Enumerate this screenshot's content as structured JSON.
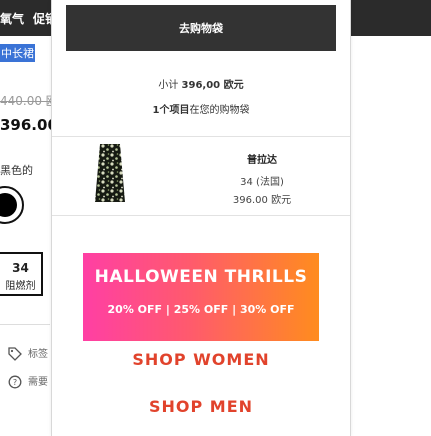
{
  "background_page": {
    "nav": [
      "氧气",
      "促销"
    ],
    "highlighted_text": "中长裙",
    "old_price": "440.00 欧",
    "price": "396.00",
    "color_label": "黑色的",
    "size_value": "34",
    "size_note": "阻燃剂",
    "info_rows": [
      "标签",
      "需要"
    ]
  },
  "mini_cart": {
    "checkout_button": "去购物袋",
    "subtotal_label": "小计 ",
    "subtotal_value": "396,00 欧元",
    "item_count_prefix": "1个项目",
    "item_count_suffix": "在您的购物袋",
    "item": {
      "name": "普拉达",
      "size": "34 (法国)",
      "price": "396.00 欧元"
    },
    "banner": {
      "title": "HALLOWEEN THRILLS",
      "offer": "20% OFF | 25% OFF | 30% OFF"
    },
    "links": {
      "women": "SHOP WOMEN",
      "men": "SHOP MEN"
    }
  },
  "colors": {
    "accent": "#e1432c",
    "button_bg": "#333333"
  }
}
